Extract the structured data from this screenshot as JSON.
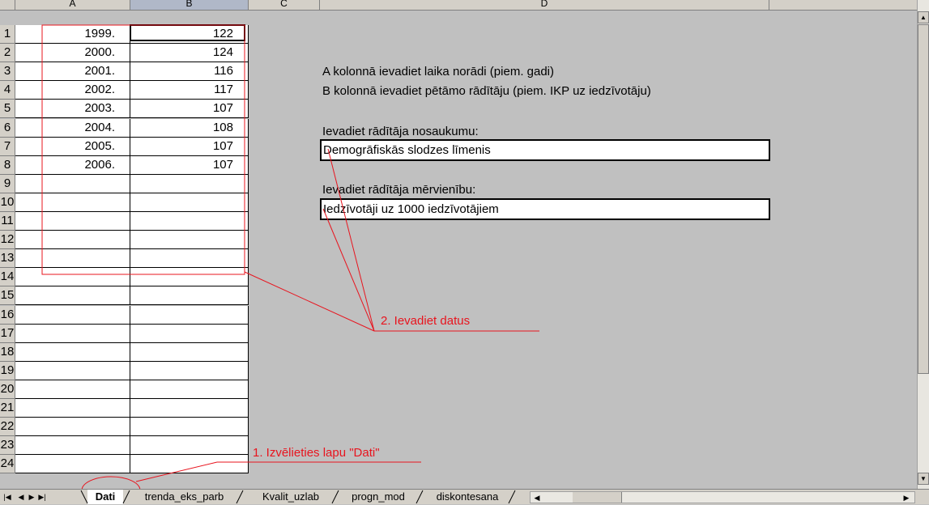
{
  "columns": [
    "A",
    "B",
    "C",
    "D"
  ],
  "rows": [
    "1",
    "2",
    "3",
    "4",
    "5",
    "6",
    "7",
    "8",
    "9",
    "10",
    "11",
    "12",
    "13",
    "14",
    "15",
    "16",
    "17",
    "18",
    "19",
    "20",
    "21",
    "22",
    "23",
    "24"
  ],
  "data_rows": [
    {
      "a": "1999.",
      "b": "122"
    },
    {
      "a": "2000.",
      "b": "124"
    },
    {
      "a": "2001.",
      "b": "116"
    },
    {
      "a": "2002.",
      "b": "117"
    },
    {
      "a": "2003.",
      "b": "107"
    },
    {
      "a": "2004.",
      "b": "108"
    },
    {
      "a": "2005.",
      "b": "107"
    },
    {
      "a": "2006.",
      "b": "107"
    }
  ],
  "instructions": {
    "line1": "A kolonnā ievadiet laika norādi (piem. gadi)",
    "line2": "B kolonnā ievadiet pētāmo rādītāju (piem. IKP uz iedzīvotāju)",
    "name_label": "Ievadiet rādītāja nosaukumu:",
    "name_value": "Demogrāfiskās slodzes līmenis",
    "unit_label": "Ievadiet rādītāja mērvienību:",
    "unit_value": "Iedzīvotāji uz 1000 iedzīvotājiem"
  },
  "annotations": {
    "step1": "1. Izvēlieties lapu \"Dati\"",
    "step2": "2. Ievadiet datus",
    "color": "#e8141e"
  },
  "sheet_tabs": [
    "Dati",
    "trenda_eks_parb",
    "Kvalit_uzlab",
    "progn_mod",
    "diskontesana"
  ],
  "active_tab": "Dati"
}
